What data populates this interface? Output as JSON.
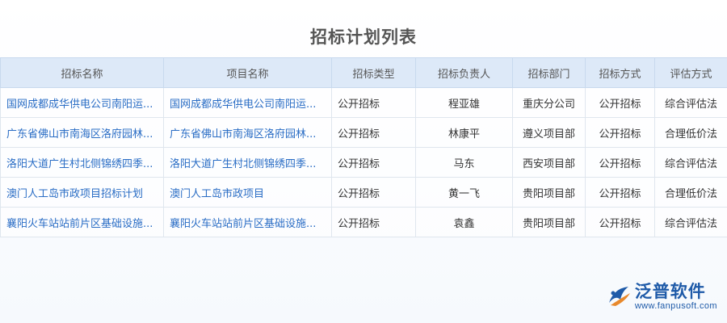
{
  "page": {
    "title": "招标计划列表"
  },
  "table": {
    "columns": [
      "招标名称",
      "项目名称",
      "招标类型",
      "招标负责人",
      "招标部门",
      "招标方式",
      "评估方式"
    ],
    "rows": [
      [
        "国网成都成华供电公司南阳运...",
        "国网成都成华供电公司南阳运...",
        "公开招标",
        "程亚雄",
        "重庆分公司",
        "公开招标",
        "综合评估法"
      ],
      [
        "广东省佛山市南海区洛府园林...",
        "广东省佛山市南海区洛府园林...",
        "公开招标",
        "林康平",
        "遵义项目部",
        "公开招标",
        "合理低价法"
      ],
      [
        "洛阳大道广生村北侧锦绣四季...",
        "洛阳大道广生村北侧锦绣四季...",
        "公开招标",
        "马东",
        "西安项目部",
        "公开招标",
        "综合评估法"
      ],
      [
        "澳门人工岛市政项目招标计划",
        "澳门人工岛市政项目",
        "公开招标",
        "黄一飞",
        "贵阳项目部",
        "公开招标",
        "合理低价法"
      ],
      [
        "襄阳火车站站前片区基础设施...",
        "襄阳火车站站前片区基础设施...",
        "公开招标",
        "袁鑫",
        "贵阳项目部",
        "公开招标",
        "综合评估法"
      ]
    ]
  },
  "brand": {
    "name": "泛普软件",
    "url": "www.fanpusoft.com",
    "color": "#1e5aa8",
    "icon": "fanpu-logo-icon"
  }
}
